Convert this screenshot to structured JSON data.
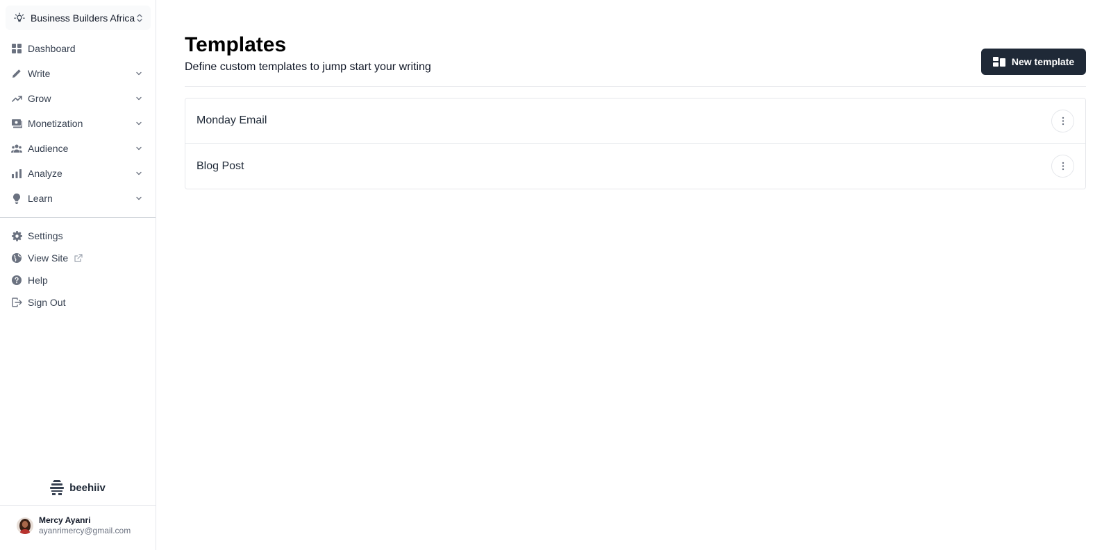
{
  "publication": {
    "name": "Business Builders Africa",
    "icon": "lightbulb-icon"
  },
  "nav": {
    "items": [
      {
        "label": "Dashboard",
        "icon": "dashboard-grid-icon",
        "expandable": false
      },
      {
        "label": "Write",
        "icon": "pencil-icon",
        "expandable": true
      },
      {
        "label": "Grow",
        "icon": "trending-up-icon",
        "expandable": true
      },
      {
        "label": "Monetization",
        "icon": "cash-icon",
        "expandable": true
      },
      {
        "label": "Audience",
        "icon": "users-icon",
        "expandable": true
      },
      {
        "label": "Analyze",
        "icon": "bar-chart-icon",
        "expandable": true
      },
      {
        "label": "Learn",
        "icon": "lightbulb-icon",
        "expandable": true
      }
    ],
    "secondary": [
      {
        "label": "Settings",
        "icon": "gear-icon"
      },
      {
        "label": "View Site",
        "icon": "globe-icon"
      },
      {
        "label": "Help",
        "icon": "question-icon"
      },
      {
        "label": "Sign Out",
        "icon": "sign-out-icon"
      }
    ]
  },
  "brand": {
    "name": "beehiiv"
  },
  "user": {
    "name": "Mercy Ayanri",
    "email": "ayanrimercy@gmail.com"
  },
  "page": {
    "title": "Templates",
    "subtitle": "Define custom templates to jump start your writing",
    "new_button_label": "New template"
  },
  "templates": [
    {
      "name": "Monday Email"
    },
    {
      "name": "Blog Post"
    }
  ],
  "colors": {
    "primary_button": "#1f2937",
    "border": "#e5e7eb",
    "icon_gray": "#6b7280"
  }
}
